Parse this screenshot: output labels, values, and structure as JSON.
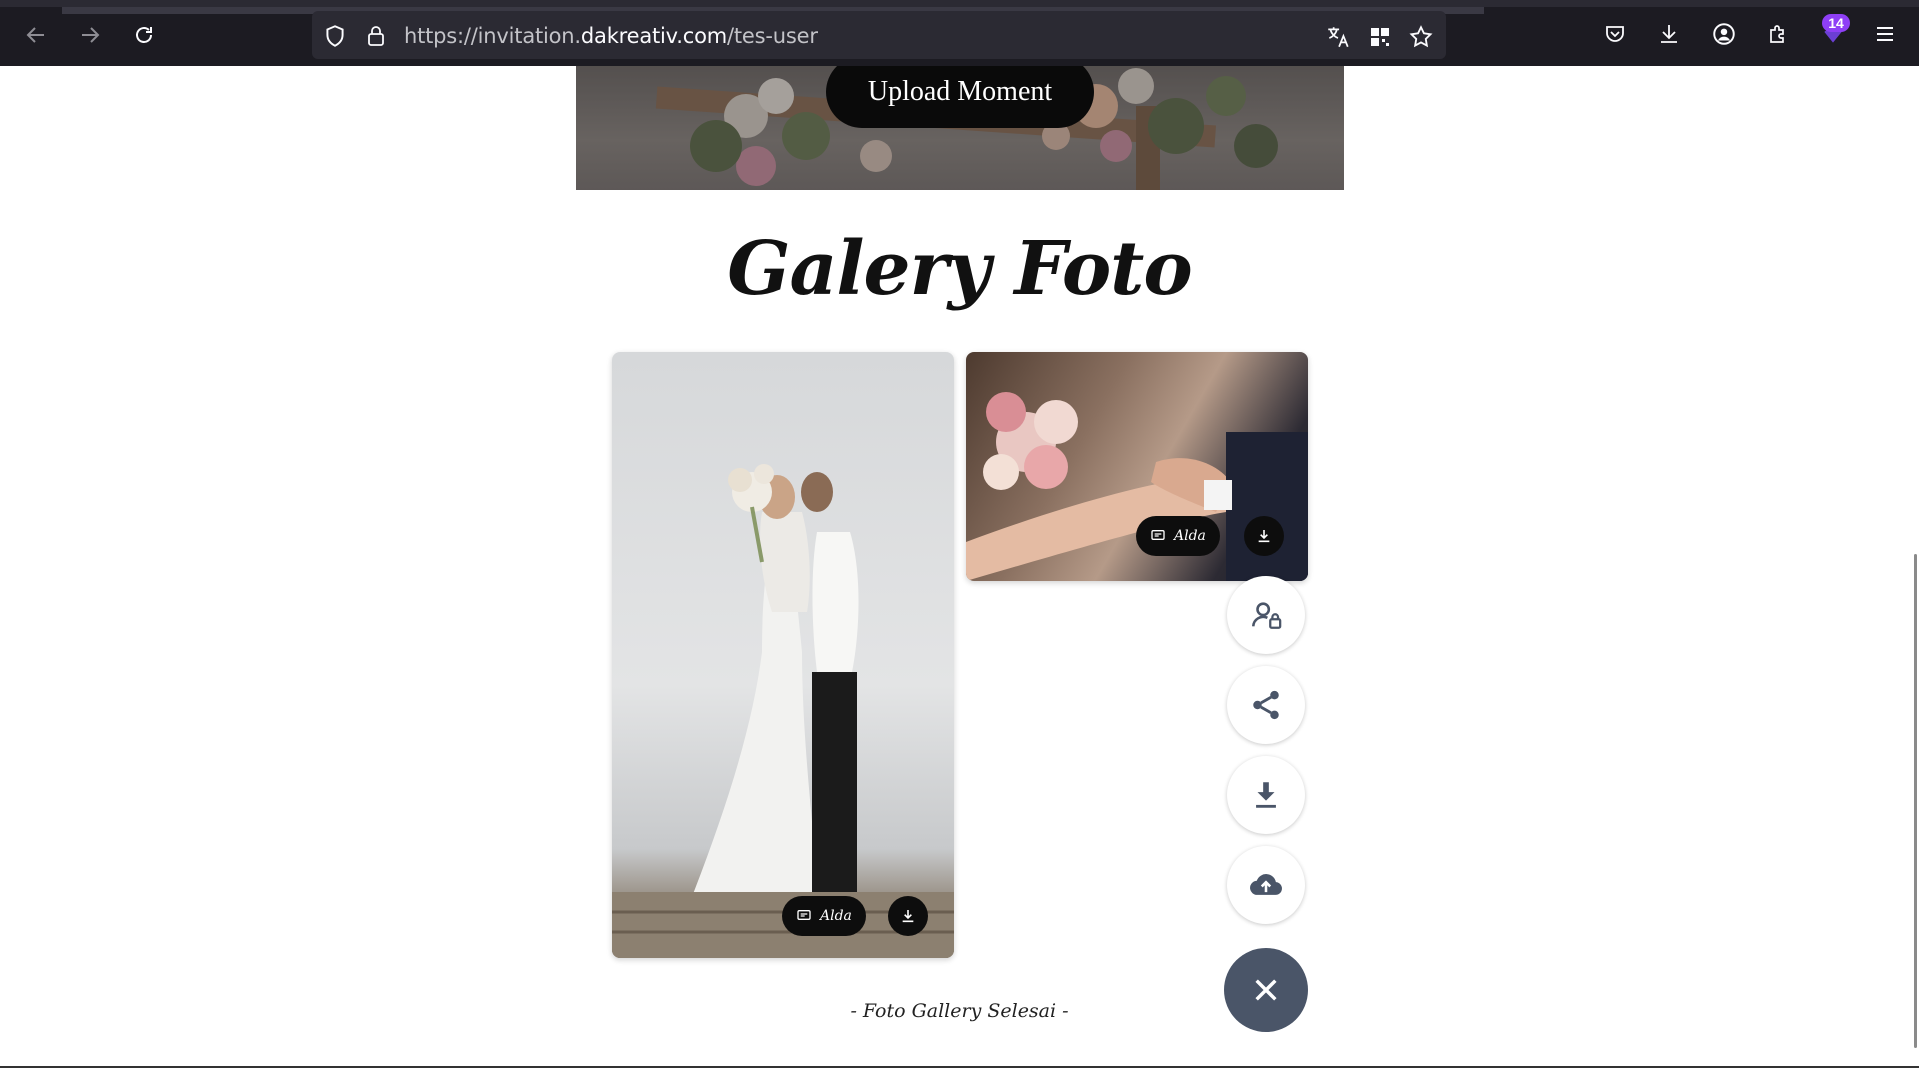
{
  "browser": {
    "url_prefix": "https://invitation.",
    "url_host": "dakreativ.com",
    "url_path": "/tes-user",
    "extensions_badge": "14"
  },
  "hero": {
    "upload_label": "Upload Moment"
  },
  "gallery": {
    "title": "Galery Foto",
    "photos": [
      {
        "caption": "Alda"
      },
      {
        "caption": "Alda"
      }
    ],
    "end_note": "- Foto Gallery Selesai -"
  },
  "colors": {
    "fab_close": "#4a5568",
    "chrome_bg": "#1c1b22",
    "urlbar_bg": "#2b2a33",
    "badge": "#8f3ff6"
  },
  "icons": {
    "fab_menu": [
      "user-lock-icon",
      "share-icon",
      "download-icon",
      "cloud-upload-icon",
      "close-icon"
    ]
  }
}
